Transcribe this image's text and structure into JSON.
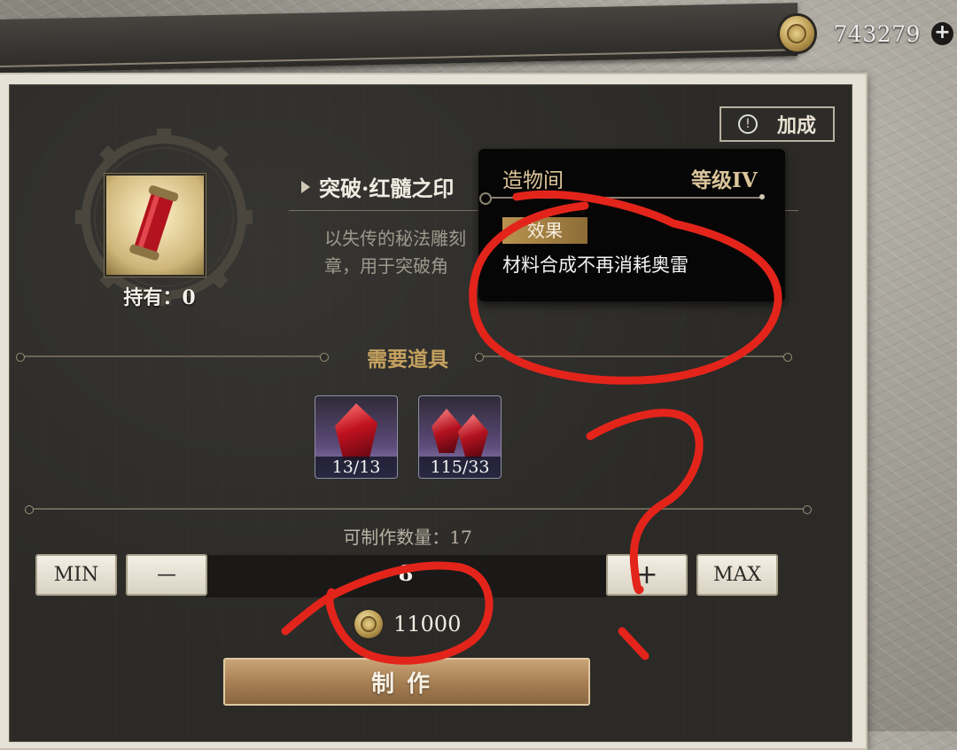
{
  "currency": {
    "amount": "743279",
    "add_symbol": "+"
  },
  "bonus_button": {
    "icon_glyph": "!",
    "label": "加成"
  },
  "item": {
    "name": "突破·红髓之印",
    "description_line1": "以失传的秘法雕刻",
    "description_line2": "章，用于突破角",
    "owned": "持有：0"
  },
  "required": {
    "title": "需要道具",
    "materials": [
      {
        "count": "13/13"
      },
      {
        "count": "115/33"
      }
    ]
  },
  "craft": {
    "can_make": "可制作数量：17",
    "min_label": "MIN",
    "minus_label": "—",
    "quantity": "8",
    "plus_label": "+",
    "max_label": "MAX",
    "cost": "11000",
    "make_label": "制作"
  },
  "tooltip": {
    "title": "造物间",
    "level": "等级IV",
    "effect_tag": "效果",
    "effect_text": "材料合成不再消耗奥雷"
  },
  "colors": {
    "annotation_red": "#e3241b",
    "gold_accent": "#c6a25f",
    "panel_dark": "#2b2a27"
  }
}
